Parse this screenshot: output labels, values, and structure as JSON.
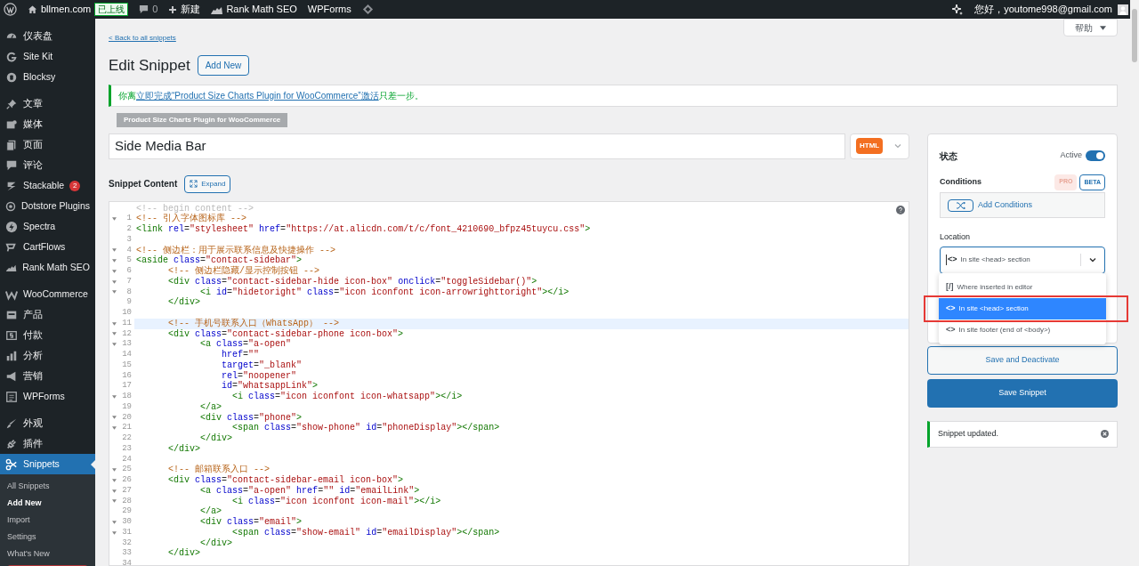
{
  "admin_bar": {
    "site": "bllmen.com",
    "live_badge": "已上线",
    "comments": "0",
    "new": "新建",
    "items": [
      "Rank Math SEO",
      "WPForms"
    ],
    "greeting": "您好，youtome998@gmail.com"
  },
  "sidebar": {
    "groups": [
      [
        {
          "label": "仪表盘",
          "selected": false
        },
        {
          "label": "Site Kit",
          "selected": false
        },
        {
          "label": "Blocksy",
          "selected": false
        }
      ],
      [
        {
          "label": "文章",
          "selected": false
        },
        {
          "label": "媒体",
          "selected": false
        },
        {
          "label": "页面",
          "selected": false
        },
        {
          "label": "评论",
          "selected": false
        },
        {
          "label": "Stackable",
          "badge": "2",
          "selected": false
        },
        {
          "label": "Dotstore Plugins",
          "selected": false
        },
        {
          "label": "Spectra",
          "selected": false
        },
        {
          "label": "CartFlows",
          "selected": false
        },
        {
          "label": "Rank Math SEO",
          "selected": false
        }
      ],
      [
        {
          "label": "WooCommerce",
          "selected": false
        },
        {
          "label": "产品",
          "selected": false
        },
        {
          "label": "付款",
          "selected": false
        },
        {
          "label": "分析",
          "selected": false
        },
        {
          "label": "营销",
          "selected": false
        },
        {
          "label": "WPForms",
          "selected": false
        }
      ],
      [
        {
          "label": "外观",
          "selected": false
        },
        {
          "label": "插件",
          "selected": false
        },
        {
          "label": "Snippets",
          "selected": true,
          "children": [
            {
              "label": "All Snippets",
              "selected": false
            },
            {
              "label": "Add New",
              "selected": true
            },
            {
              "label": "Import",
              "selected": false
            },
            {
              "label": "Settings",
              "selected": false
            },
            {
              "label": "What's New",
              "selected": false
            }
          ]
        }
      ]
    ]
  },
  "help_button": "帮助",
  "back_link": "< Back to all snippets",
  "page_title": "Edit Snippet",
  "add_new_button": "Add New",
  "notice": {
    "prefix": "你离",
    "link": "立即完成“Product Size Charts Plugin for WooCommerce”激活",
    "suffix": "只差一步。",
    "tag": "Product Size Charts Plugin for WooCommerce"
  },
  "snippet_title": "Side Media Bar",
  "type_badge": "HTML",
  "content_label": "Snippet Content",
  "expand_button": "Expand",
  "editor": {
    "header": "<!-- begin content -->",
    "lines": [
      {
        "n": "1",
        "text": "<!-- 引入字体图标库 -->",
        "fold": true,
        "active": false
      },
      {
        "n": "2",
        "text": "<link rel=\"stylesheet\" href=\"https://at.alicdn.com/t/c/font_4210690_bfpz45tuycu.css\">",
        "fold": false,
        "active": false
      },
      {
        "n": "3",
        "fold": false,
        "active": false
      },
      {
        "n": "4",
        "text": "<!-- 侧边栏：用于展示联系信息及快捷操作 -->",
        "fold": true,
        "active": false
      },
      {
        "n": "5",
        "text": "<aside class=\"contact-sidebar\">",
        "fold": true,
        "active": false
      },
      {
        "n": "6",
        "text": "      <!-- 侧边栏隐藏/显示控制按钮 -->",
        "fold": true,
        "active": false
      },
      {
        "n": "7",
        "text": "      <div class=\"contact-sidebar-hide icon-box\" onclick=\"toggleSidebar()\">",
        "fold": true,
        "active": false
      },
      {
        "n": "8",
        "text": "            <i id=\"hidetoright\" class=\"icon iconfont icon-arrowrighttoright\"></i>",
        "fold": true,
        "active": false
      },
      {
        "n": "9",
        "text": "      </div>",
        "fold": false,
        "active": false
      },
      {
        "n": "10",
        "fold": false,
        "active": false
      },
      {
        "n": "11",
        "text": "      <!-- 手机号联系入口（WhatsApp） -->",
        "fold": true,
        "active": true
      },
      {
        "n": "12",
        "text": "      <div class=\"contact-sidebar-phone icon-box\">",
        "fold": true,
        "active": false
      },
      {
        "n": "13",
        "text": "            <a class=\"a-open\"",
        "fold": true,
        "active": false
      },
      {
        "n": "14",
        "text": "                href=\"\"",
        "fold": false,
        "active": false
      },
      {
        "n": "15",
        "text": "                target=\"_blank\"",
        "fold": false,
        "active": false
      },
      {
        "n": "16",
        "text": "                rel=\"noopener\"",
        "fold": false,
        "active": false
      },
      {
        "n": "17",
        "text": "                id=\"whatsappLink\">",
        "fold": false,
        "active": false
      },
      {
        "n": "18",
        "text": "                  <i class=\"icon iconfont icon-whatsapp\"></i>",
        "fold": true,
        "active": false
      },
      {
        "n": "19",
        "text": "            </a>",
        "fold": false,
        "active": false
      },
      {
        "n": "20",
        "text": "            <div class=\"phone\">",
        "fold": true,
        "active": false
      },
      {
        "n": "21",
        "text": "                  <span class=\"show-phone\" id=\"phoneDisplay\"></span>",
        "fold": true,
        "active": false
      },
      {
        "n": "22",
        "text": "            </div>",
        "fold": false,
        "active": false
      },
      {
        "n": "23",
        "text": "      </div>",
        "fold": false,
        "active": false
      },
      {
        "n": "24",
        "fold": false,
        "active": false
      },
      {
        "n": "25",
        "text": "      <!-- 邮箱联系入口 -->",
        "fold": true,
        "active": false
      },
      {
        "n": "26",
        "text": "      <div class=\"contact-sidebar-email icon-box\">",
        "fold": true,
        "active": false
      },
      {
        "n": "27",
        "text": "            <a class=\"a-open\" href=\"\" id=\"emailLink\">",
        "fold": true,
        "active": false
      },
      {
        "n": "28",
        "text": "                  <i class=\"icon iconfont icon-mail\"></i>",
        "fold": true,
        "active": false
      },
      {
        "n": "29",
        "text": "            </a>",
        "fold": false,
        "active": false
      },
      {
        "n": "30",
        "text": "            <div class=\"email\">",
        "fold": true,
        "active": false
      },
      {
        "n": "31",
        "text": "                  <span class=\"show-email\" id=\"emailDisplay\"></span>",
        "fold": true,
        "active": false
      },
      {
        "n": "32",
        "text": "            </div>",
        "fold": false,
        "active": false
      },
      {
        "n": "33",
        "text": "      </div>",
        "fold": false,
        "active": false
      },
      {
        "n": "34",
        "fold": false,
        "active": false
      }
    ]
  },
  "panel": {
    "status_label": "状态",
    "active_label": "Active",
    "active": true,
    "conditions_label": "Conditions",
    "pro_badge": "PRO",
    "beta_badge": "BETA",
    "add_conditions": "Add Conditions",
    "location_label": "Location",
    "location_icon": "<>",
    "location_value": "In site <head> section",
    "location_open": true,
    "location_options": [
      {
        "icon": "[/]",
        "label": "Where inserted in editor",
        "selected": false,
        "highlighted": false
      },
      {
        "icon": "<>",
        "label": "In site <head> section",
        "selected": true,
        "highlighted": true
      },
      {
        "icon": "<>",
        "label": "In site footer (end of <body>)",
        "selected": false,
        "highlighted": false
      }
    ]
  },
  "save_deactivate_button": "Save and Deactivate",
  "save_button": "Save Snippet",
  "updated_notice": "Snippet updated."
}
